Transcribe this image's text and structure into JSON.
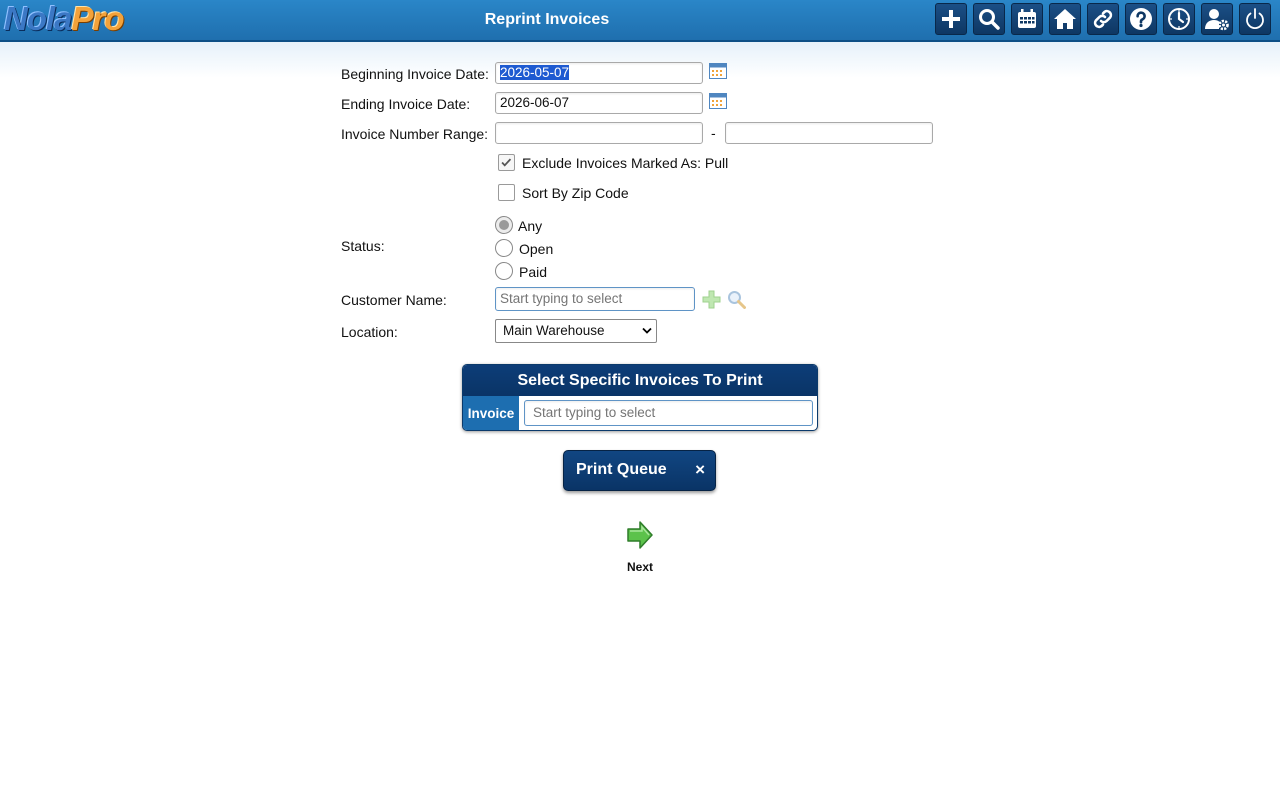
{
  "header": {
    "logo_nola": "Nola",
    "logo_pro": "Pro",
    "title": "Reprint Invoices",
    "toolbar": [
      "plus-icon",
      "search-icon",
      "calendar-icon",
      "home-icon",
      "link-icon",
      "help-icon",
      "clock-icon",
      "user-settings-icon",
      "power-icon"
    ]
  },
  "form": {
    "begin_label": "Beginning Invoice Date:",
    "begin_value": "2026-05-07",
    "end_label": "Ending Invoice Date:",
    "end_value": "2026-06-07",
    "range_label": "Invoice Number Range:",
    "range_from": "",
    "range_dash": "-",
    "range_to": "",
    "exclude_label": "Exclude Invoices Marked As: Pull",
    "exclude_checked": true,
    "sort_label": "Sort By Zip Code",
    "sort_checked": false,
    "status_label": "Status:",
    "status_options": [
      "Any",
      "Open",
      "Paid"
    ],
    "status_selected": "Any",
    "customer_label": "Customer Name:",
    "customer_placeholder": "Start typing to select",
    "location_label": "Location:",
    "location_value": "Main Warehouse"
  },
  "specific": {
    "title": "Select Specific Invoices To Print",
    "invoice_label": "Invoice",
    "invoice_placeholder": "Start typing to select"
  },
  "print_queue": {
    "label": "Print Queue",
    "close": "×"
  },
  "next": {
    "label": "Next"
  },
  "colors": {
    "header": "#1f6fae",
    "dark_blue": "#0a3466",
    "accent_green": "#5cc24b"
  }
}
